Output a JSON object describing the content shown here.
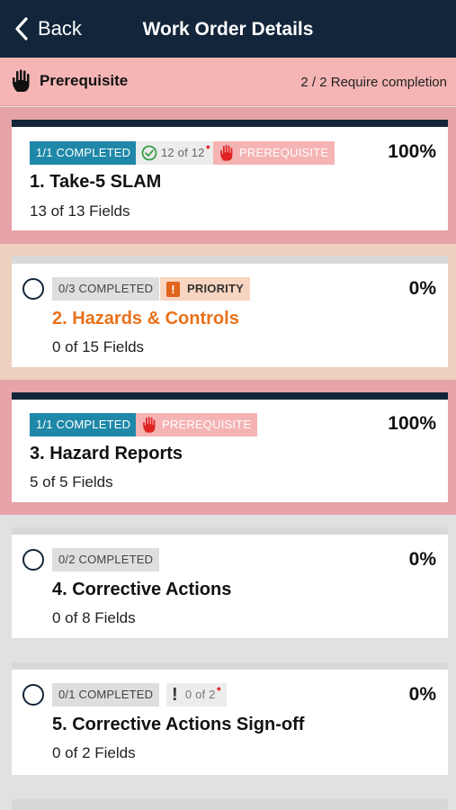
{
  "nav": {
    "back_label": "Back",
    "title": "Work Order Details"
  },
  "prereq_bar": {
    "label": "Prerequisite",
    "requirement": "2 / 2 Require completion"
  },
  "items": [
    {
      "completed": "1/1 COMPLETED",
      "check": "12 of 12",
      "prereq": "PREREQUISITE",
      "percent": "100%",
      "title": "1. Take-5 SLAM",
      "fields": "13 of 13 Fields"
    },
    {
      "completed": "0/3 COMPLETED",
      "priority": "PRIORITY",
      "percent": "0%",
      "title": "2. Hazards & Controls",
      "fields": "0 of 15 Fields"
    },
    {
      "completed": "1/1 COMPLETED",
      "prereq": "PREREQUISITE",
      "percent": "100%",
      "title": "3. Hazard Reports",
      "fields": "5 of 5 Fields"
    },
    {
      "completed": "0/2 COMPLETED",
      "percent": "0%",
      "title": "4. Corrective Actions",
      "fields": "0 of 8 Fields"
    },
    {
      "completed": "0/1 COMPLETED",
      "warn": "0 of 2",
      "percent": "0%",
      "title": "5. Corrective Actions Sign-off",
      "fields": "0 of 2 Fields"
    }
  ],
  "icons": [
    "chevron-left-icon",
    "hand-stop-icon",
    "check-circle-icon",
    "priority-icon",
    "exclamation-icon",
    "radio-icon"
  ],
  "colors": {
    "nav": "#12253a",
    "completed_badge": "#1f88a8",
    "prereq_bar": "#f5b5b5",
    "priority": "#e0641c",
    "hazards_title": "#e8701a"
  }
}
